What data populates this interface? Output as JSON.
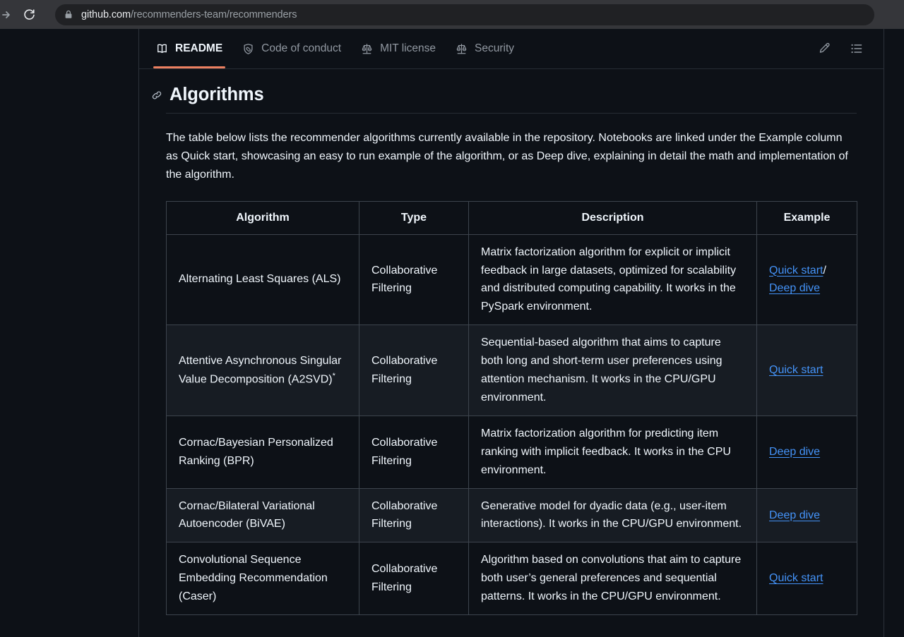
{
  "browser": {
    "back_icon": "forward-arrow-icon",
    "reload_icon": "reload-icon",
    "lock_icon": "lock-icon",
    "url_host": "github.com",
    "url_path": "/recommenders-team/recommenders"
  },
  "tabbar": {
    "tabs": [
      {
        "label": "README",
        "icon": "book-icon",
        "active": true
      },
      {
        "label": "Code of conduct",
        "icon": "heart-shield-icon",
        "active": false
      },
      {
        "label": "MIT license",
        "icon": "scale-icon",
        "active": false
      },
      {
        "label": "Security",
        "icon": "scale-icon",
        "active": false
      }
    ],
    "actions": [
      {
        "name": "edit-pencil-icon",
        "label": "Edit"
      },
      {
        "name": "outline-list-icon",
        "label": "Outline"
      }
    ],
    "active_underline_color": "#ec8060"
  },
  "readme": {
    "anchor_icon": "link-anchor-icon",
    "heading": "Algorithms",
    "paragraph": "The table below lists the recommender algorithms currently available in the repository. Notebooks are linked under the Example column as Quick start, showcasing an easy to run example of the algorithm, or as Deep dive, explaining in detail the math and implementation of the algorithm.",
    "link_color": "#4493f8"
  },
  "table": {
    "headers": [
      "Algorithm",
      "Type",
      "Description",
      "Example"
    ],
    "rows": [
      {
        "algorithm": "Alternating Least Squares (ALS)",
        "starred": false,
        "type": "Collaborative Filtering",
        "description": "Matrix factorization algorithm for explicit or implicit feedback in large datasets, optimized for scalability and distributed computing capability. It works in the PySpark environment.",
        "examples": [
          "Quick start",
          "Deep dive"
        ],
        "separator": "/"
      },
      {
        "algorithm": "Attentive Asynchronous Singular Value Decomposition (A2SVD)",
        "starred": true,
        "type": "Collaborative Filtering",
        "description": "Sequential-based algorithm that aims to capture both long and short-term user preferences using attention mechanism. It works in the CPU/GPU environment.",
        "examples": [
          "Quick start"
        ],
        "separator": ""
      },
      {
        "algorithm": "Cornac/Bayesian Personalized Ranking (BPR)",
        "starred": false,
        "type": "Collaborative Filtering",
        "description": "Matrix factorization algorithm for predicting item ranking with implicit feedback. It works in the CPU environment.",
        "examples": [
          "Deep dive"
        ],
        "separator": ""
      },
      {
        "algorithm": "Cornac/Bilateral Variational Autoencoder (BiVAE)",
        "starred": false,
        "type": "Collaborative Filtering",
        "description": "Generative model for dyadic data (e.g., user-item interactions). It works in the CPU/GPU environment.",
        "examples": [
          "Deep dive"
        ],
        "separator": ""
      },
      {
        "algorithm": "Convolutional Sequence Embedding Recommendation (Caser)",
        "starred": false,
        "type": "Collaborative Filtering",
        "description": "Algorithm based on convolutions that aim to capture both user’s general preferences and sequential patterns. It works in the CPU/GPU environment.",
        "examples": [
          "Quick start"
        ],
        "separator": ""
      }
    ]
  }
}
